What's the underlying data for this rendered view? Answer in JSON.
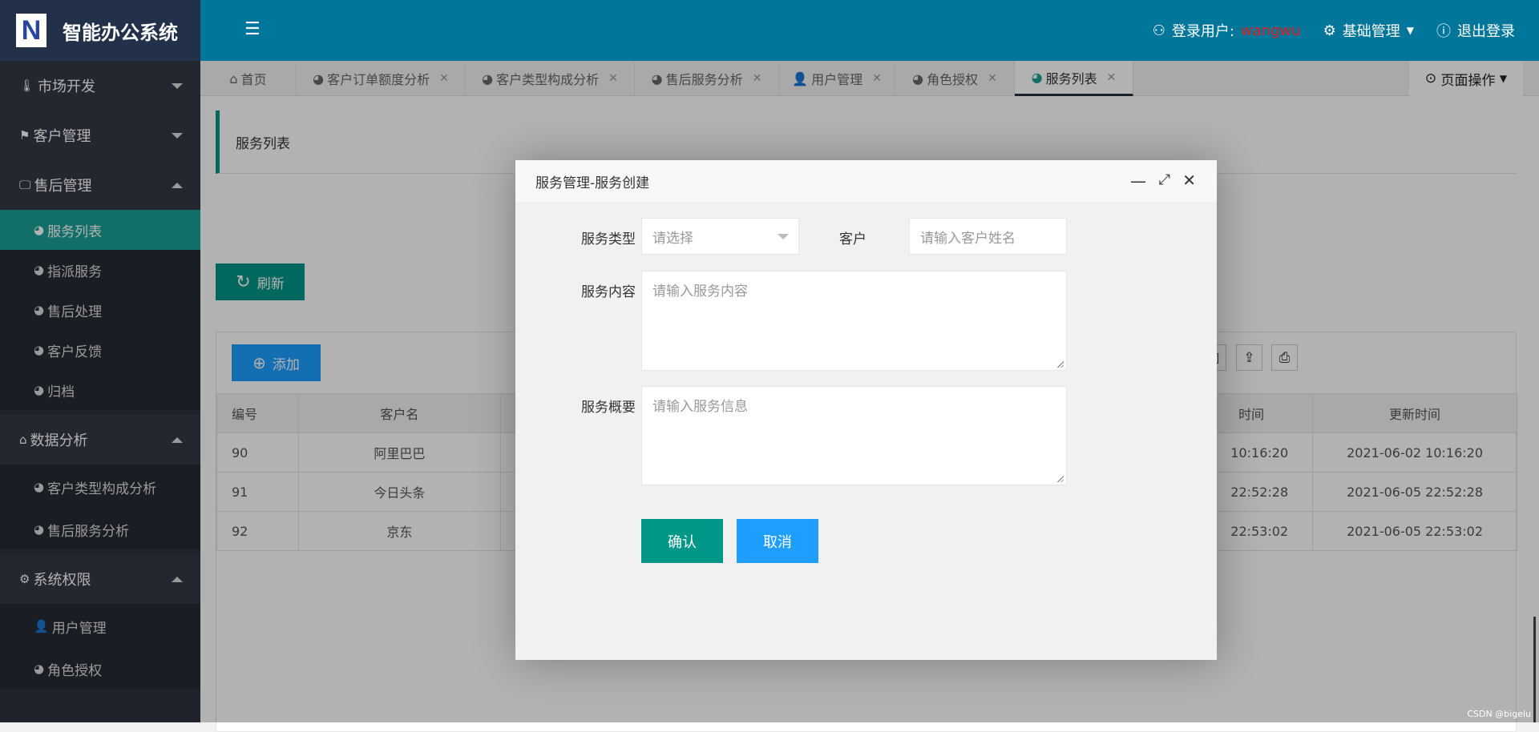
{
  "app": {
    "title": "智能办公系统",
    "logo_letter": "N"
  },
  "header": {
    "user_label": "登录用户:",
    "username": "wangwu",
    "basic_mgmt": "基础管理",
    "logout": "退出登录"
  },
  "sidebar": {
    "sections": [
      {
        "label": "市场开发",
        "expanded": false,
        "items": []
      },
      {
        "label": "客户管理",
        "expanded": false,
        "items": []
      },
      {
        "label": "售后管理",
        "expanded": true,
        "items": [
          "服务列表",
          "指派服务",
          "售后处理",
          "客户反馈",
          "归档"
        ]
      },
      {
        "label": "数据分析",
        "expanded": true,
        "items": [
          "客户类型构成分析",
          "售后服务分析"
        ]
      },
      {
        "label": "系统权限",
        "expanded": true,
        "items": [
          "用户管理",
          "角色授权"
        ]
      }
    ],
    "active_item": "服务列表"
  },
  "tabs": [
    "首页",
    "客户订单额度分析",
    "客户类型构成分析",
    "售后服务分析",
    "用户管理",
    "角色授权",
    "服务列表"
  ],
  "active_tab": "服务列表",
  "page_ops": "页面操作",
  "page": {
    "breadcrumb": "服务列表",
    "refresh": "刷新",
    "add": "添加",
    "table": {
      "headers": {
        "id": "编号",
        "customer": "客户名",
        "created_fragment": "时间",
        "updated": "更新时间"
      },
      "rows": [
        {
          "id": "90",
          "customer": "阿里巴巴",
          "created_fragment": "10:16:20",
          "updated": "2021-06-02 10:16:20"
        },
        {
          "id": "91",
          "customer": "今日头条",
          "created_fragment": "22:52:28",
          "updated": "2021-06-05 22:52:28"
        },
        {
          "id": "92",
          "customer": "京东",
          "created_fragment": "22:53:02",
          "updated": "2021-06-05 22:53:02"
        }
      ]
    }
  },
  "modal": {
    "title": "服务管理-服务创建",
    "service_type_label": "服务类型",
    "service_type_placeholder": "请选择",
    "customer_label": "客户",
    "customer_placeholder": "请输入客户姓名",
    "content_label": "服务内容",
    "content_placeholder": "请输入服务内容",
    "summary_label": "服务概要",
    "summary_placeholder": "请输入服务信息",
    "confirm": "确认",
    "cancel": "取消"
  },
  "watermark": "CSDN @bigelu",
  "colors": {
    "header": "#00779a",
    "sidebar": "#2f3340",
    "active": "#1aa094",
    "confirm": "#009688",
    "cancel": "#1e9fff",
    "add": "#1e9fff",
    "username": "#e02020"
  }
}
